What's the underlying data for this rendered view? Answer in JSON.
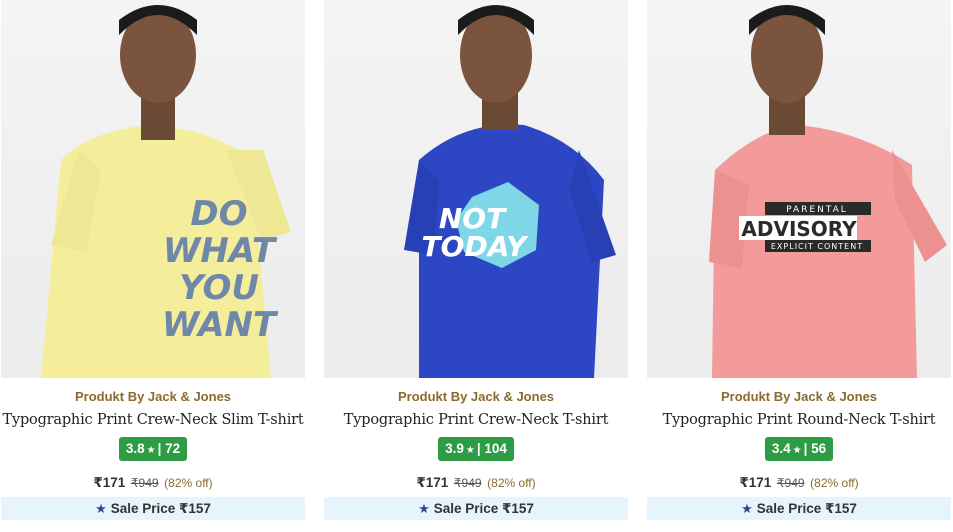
{
  "products": [
    {
      "brand": "Produkt By Jack & Jones",
      "name": "Typographic Print Crew-Neck Slim T-shirt",
      "rating": "3.8",
      "rating_count": "72",
      "price": "₹171",
      "mrp": "₹949",
      "discount": "(82% off)",
      "sale_price": "Sale Price ₹157",
      "shirt_color": "#f4ee9c",
      "print_text": [
        "DO",
        "WHAT",
        "YOU",
        "WANT"
      ]
    },
    {
      "brand": "Produkt By Jack & Jones",
      "name": "Typographic Print Crew-Neck T-shirt",
      "rating": "3.9",
      "rating_count": "104",
      "price": "₹171",
      "mrp": "₹949",
      "discount": "(82% off)",
      "sale_price": "Sale Price ₹157",
      "shirt_color": "#2c46c4",
      "print_text": [
        "NOT",
        "TODAY"
      ]
    },
    {
      "brand": "Produkt By Jack & Jones",
      "name": "Typographic Print Round-Neck T-shirt",
      "rating": "3.4",
      "rating_count": "56",
      "price": "₹171",
      "mrp": "₹949",
      "discount": "(82% off)",
      "sale_price": "Sale Price ₹157",
      "shirt_color": "#f39a9a",
      "print_text": [
        "PARENTAL",
        "ADVISORY",
        "EXPLICIT CONTENT"
      ]
    }
  ],
  "colors": {
    "rating_badge": "#2e9b45",
    "brand_text": "#8a6a2e",
    "sale_bg": "#e5f5fb",
    "star_icon": "#3a3f8f"
  },
  "icons": {
    "rating": "star-icon",
    "sale": "star-icon"
  }
}
